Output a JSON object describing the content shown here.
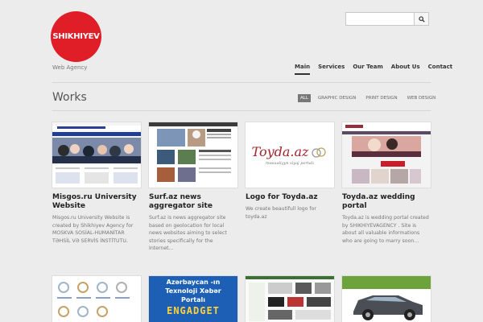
{
  "brand": {
    "logo_text": "SHIKHIYEV",
    "tagline": "Web Agency"
  },
  "search": {
    "placeholder": ""
  },
  "nav": {
    "items": [
      "Main",
      "Services",
      "Our Team",
      "About Us",
      "Contact"
    ],
    "active": "Main"
  },
  "works": {
    "title": "Works"
  },
  "filters": [
    "ALL",
    "GRAPHIC DESIGN",
    "PRINT DESIGN",
    "WEB DESIGN"
  ],
  "cards": [
    {
      "title": "Misgos.ru University Website",
      "description": "Misgos.ru University Website is created by Shikhiyev Agency for MOSKVA SOSİAL-HUMANİTAR TƏHSİL VƏ SERVİS İNSTİTUTU."
    },
    {
      "title": "Surf.az news aggregator site",
      "description": "Surf.az is news aggregator site based on geolocation for local news websites aiming to select stories specifically for the Internet..."
    },
    {
      "title": "Logo for Toyda.az",
      "description": "We create beautifull logo for toyda.az",
      "thumb_brand": "Toyda.az",
      "thumb_sub": "məsuəliyyn siyaj portalı"
    },
    {
      "title": "Toyda.az wedding portal",
      "description": "Toyda.az is wedding portal created by SHIKHIYEVAGENCY . Site is about all valuable informations who are going to marry soon..."
    }
  ],
  "second_row_texts": {
    "banner_line1": "Azərbaycan -ın",
    "banner_line2": "Texnoloji Xəbər",
    "banner_line3": "Portalı",
    "banner_word": "ENGADGET"
  },
  "colors": {
    "brand_red": "#e01e27",
    "bg": "#ececec",
    "active_filter": "#777777"
  }
}
